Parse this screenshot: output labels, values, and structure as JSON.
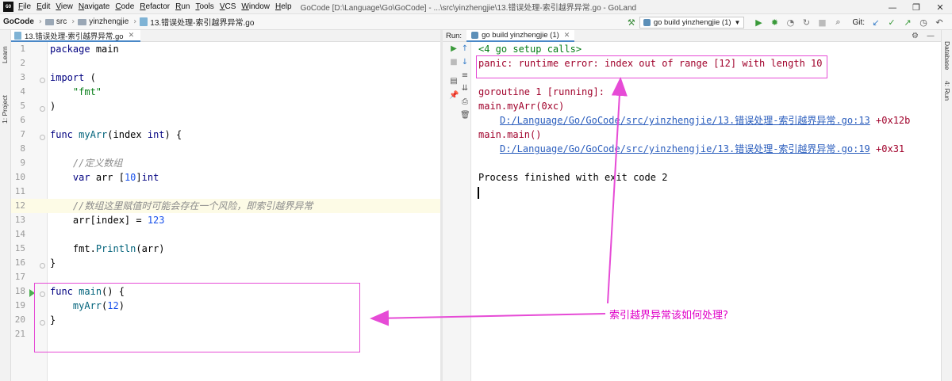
{
  "menubar": {
    "app_icon": "GO",
    "items": [
      "File",
      "Edit",
      "View",
      "Navigate",
      "Code",
      "Refactor",
      "Run",
      "Tools",
      "VCS",
      "Window",
      "Help"
    ],
    "window_title": "GoCode [D:\\Language\\Go\\GoCode] - ...\\src\\yinzhengjie\\13.错误处理-索引越界异常.go - GoLand",
    "controls": [
      "—",
      "❐",
      "✕"
    ]
  },
  "navbar": {
    "crumbs": [
      "GoCode",
      "src",
      "yinzhengjie",
      "13.错误处理-索引越界异常.go"
    ],
    "run_config": "go build yinzhengjie (1)",
    "git_label": "Git:"
  },
  "left_stripe": {
    "learn": "Learn",
    "project": "1: Project"
  },
  "right_stripe": {
    "database": "Database",
    "run": "4: Run"
  },
  "editor": {
    "tab_label": "13.错误处理-索引越界异常.go",
    "line_numbers": [
      "1",
      "2",
      "3",
      "4",
      "5",
      "6",
      "7",
      "8",
      "9",
      "10",
      "11",
      "12",
      "13",
      "14",
      "15",
      "16",
      "17",
      "18",
      "19",
      "20",
      "21"
    ]
  },
  "run_panel": {
    "label": "Run:",
    "tab_label": "go build yinzhengjie (1)"
  },
  "console": {
    "setup_calls": "<4 go setup calls>",
    "panic": "panic: runtime error: index out of range [12] with length 10",
    "goroutine": "goroutine 1 [running]:",
    "frame1_func": "main.myArr(0xc)",
    "frame1_path": "D:/Language/Go/GoCode/src/yinzhengjie/13.错误处理-索引越界异常.go:13",
    "frame1_offset": " +0x12b",
    "frame2_func": "main.main()",
    "frame2_path": "D:/Language/Go/GoCode/src/yinzhengjie/13.错误处理-索引越界异常.go:19",
    "frame2_offset": " +0x31",
    "finished": "Process finished with exit code 2"
  },
  "annotation": {
    "question": "索引越界异常该如何处理?",
    "color": "#e64bd6"
  }
}
